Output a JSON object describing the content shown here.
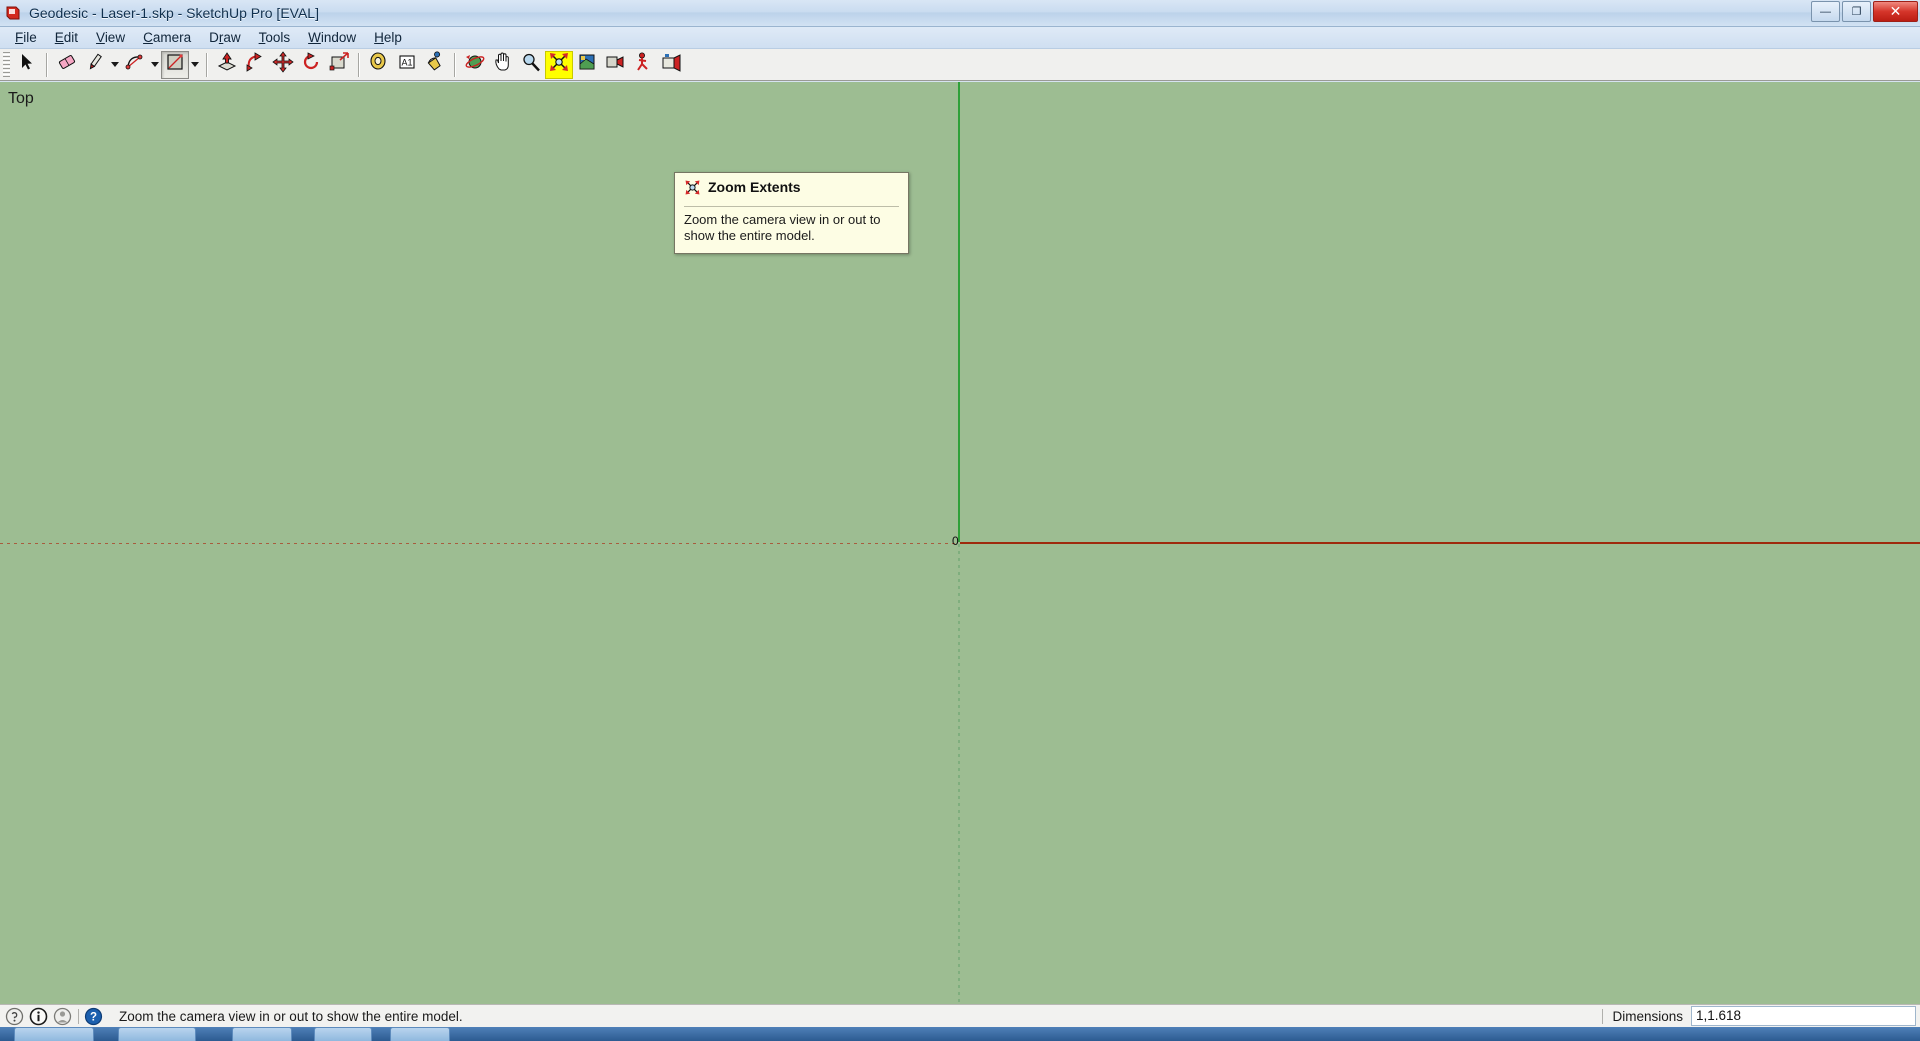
{
  "window": {
    "title": "Geodesic - Laser-1.skp - SketchUp Pro [EVAL]",
    "app_icon": "sketchup-icon",
    "minimize_label": "—",
    "maximize_label": "❐",
    "close_label": "✕"
  },
  "menubar": {
    "items": [
      {
        "label": "File",
        "mnemonic": "F"
      },
      {
        "label": "Edit",
        "mnemonic": "E"
      },
      {
        "label": "View",
        "mnemonic": "V"
      },
      {
        "label": "Camera",
        "mnemonic": "C"
      },
      {
        "label": "Draw",
        "mnemonic": "r"
      },
      {
        "label": "Tools",
        "mnemonic": "T"
      },
      {
        "label": "Window",
        "mnemonic": "W"
      },
      {
        "label": "Help",
        "mnemonic": "H"
      }
    ]
  },
  "toolbar": {
    "buttons": [
      {
        "name": "select-tool",
        "icon": "arrow-cursor-icon"
      },
      {
        "name": "eraser-tool",
        "icon": "eraser-icon"
      },
      {
        "name": "line-tool",
        "icon": "pencil-icon"
      },
      {
        "name": "arc-tool",
        "icon": "arc-icon"
      },
      {
        "name": "rectangle-tool",
        "icon": "rectangle-icon"
      },
      {
        "name": "push-pull-tool",
        "icon": "push-pull-icon"
      },
      {
        "name": "follow-me-tool",
        "icon": "follow-me-icon"
      },
      {
        "name": "move-tool",
        "icon": "move-icon"
      },
      {
        "name": "rotate-tool",
        "icon": "rotate-icon"
      },
      {
        "name": "scale-tool",
        "icon": "scale-icon"
      },
      {
        "name": "tape-measure-tool",
        "icon": "tape-measure-icon"
      },
      {
        "name": "text-tool",
        "icon": "text-a1-icon"
      },
      {
        "name": "paint-bucket-tool",
        "icon": "paint-bucket-icon"
      },
      {
        "name": "orbit-tool",
        "icon": "orbit-icon"
      },
      {
        "name": "pan-tool",
        "icon": "hand-icon"
      },
      {
        "name": "zoom-tool",
        "icon": "magnifier-icon"
      },
      {
        "name": "zoom-extents-tool",
        "icon": "zoom-extents-icon"
      },
      {
        "name": "previous-view",
        "icon": "previous-view-icon"
      },
      {
        "name": "position-camera",
        "icon": "position-camera-icon"
      },
      {
        "name": "walk-tool",
        "icon": "walk-icon"
      },
      {
        "name": "look-around-tool",
        "icon": "look-around-icon"
      }
    ]
  },
  "tooltip": {
    "icon": "zoom-extents-icon",
    "title": "Zoom Extents",
    "body": "Zoom the camera view in or out to show the entire model."
  },
  "viewport": {
    "view_label": "Top",
    "origin_label": "0",
    "background_color": "#9dbd92",
    "red_axis_color": "#9e2a0c",
    "green_axis_color": "#2fa038"
  },
  "statusbar": {
    "icons": [
      {
        "name": "help-circle-icon",
        "glyph": "?"
      },
      {
        "name": "info-circle-icon",
        "glyph": "i"
      },
      {
        "name": "person-circle-icon",
        "glyph": "●"
      },
      {
        "name": "instructor-help-icon",
        "glyph": "?"
      }
    ],
    "message": "Zoom the camera view in or out to show the entire model.",
    "dimensions_label": "Dimensions",
    "dimensions_value": "1,1.618"
  }
}
